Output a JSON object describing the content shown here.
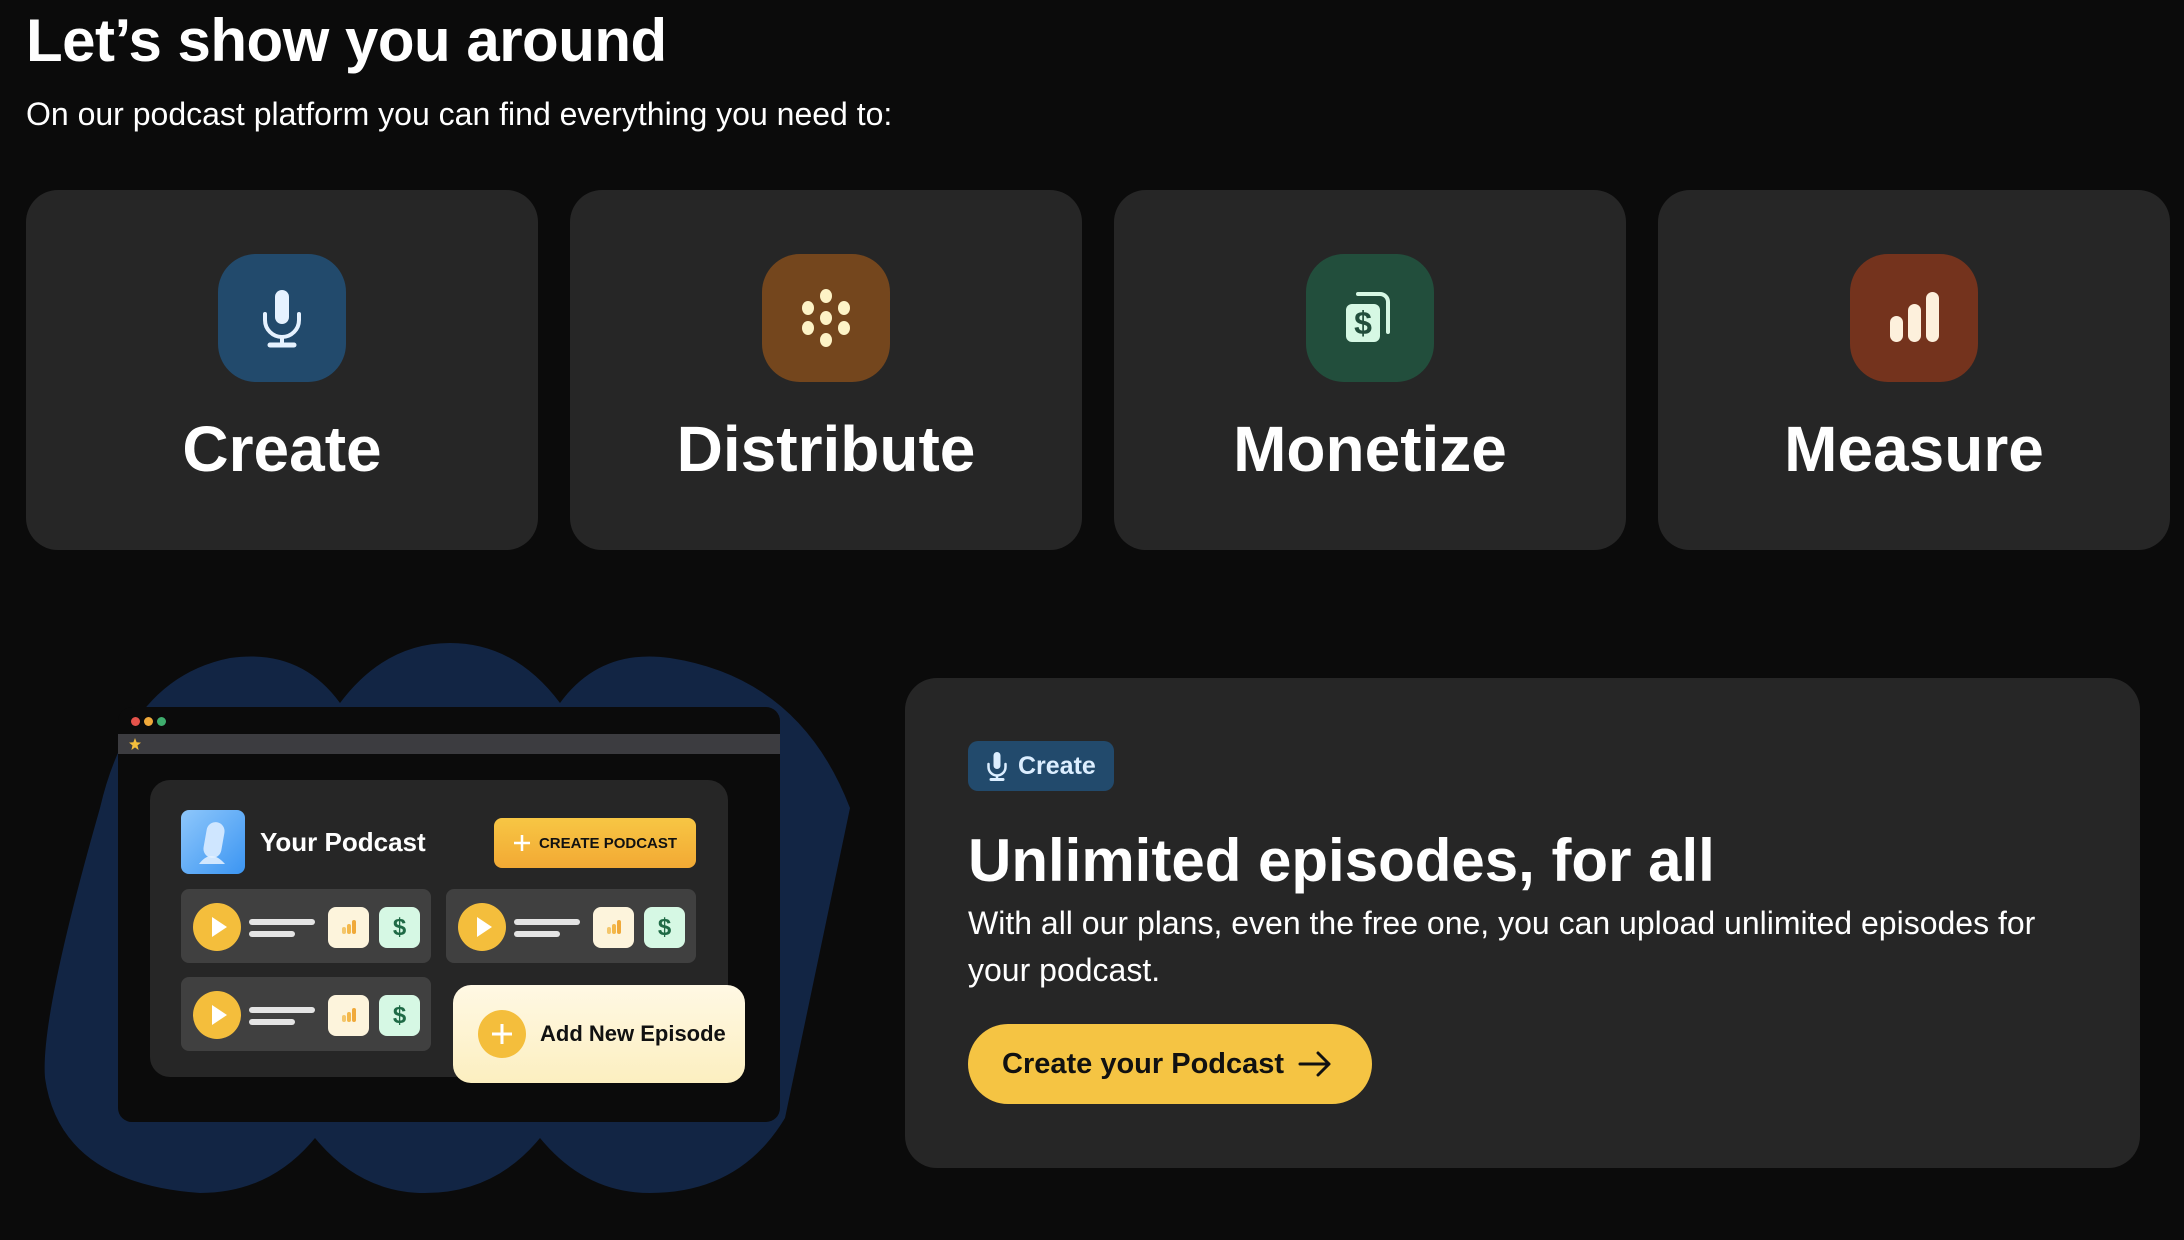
{
  "header": {
    "title": "Let’s show you around",
    "subtitle": "On our podcast platform you can find everything you need to:"
  },
  "features": [
    {
      "label": "Create",
      "icon": "microphone-icon",
      "color": "#224a6c",
      "glyph_color": "#e6f2ff"
    },
    {
      "label": "Distribute",
      "icon": "distribution-dots-icon",
      "color": "#74461d",
      "glyph_color": "#fdf3c6"
    },
    {
      "label": "Monetize",
      "icon": "money-stack-icon",
      "color": "#224e3c",
      "glyph_color": "#d6f8e4"
    },
    {
      "label": "Measure",
      "icon": "bar-chart-icon",
      "color": "#74331d",
      "glyph_color": "#fdf0dc"
    }
  ],
  "illustration": {
    "podcast_title": "Your Podcast",
    "create_button": "CREATE PODCAST",
    "add_episode": "Add New Episode",
    "episode_money_symbol": "$"
  },
  "detail": {
    "badge": "Create",
    "title": "Unlimited episodes, for all",
    "description": "With all our plans, even the free one, you can upload unlimited episodes for your podcast.",
    "cta_label": "Create your Podcast"
  },
  "colors": {
    "background": "#0b0b0b",
    "card": "#262626",
    "accent": "#f5c443",
    "blob": "#122544"
  }
}
